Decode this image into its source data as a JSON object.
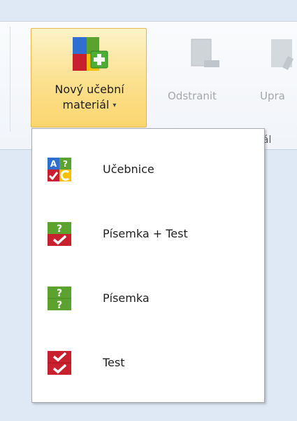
{
  "ribbon": {
    "group_label_partial": "iál",
    "new_material": {
      "label_line1": "Nový učební",
      "label_line2": "materiál",
      "caret": "▾",
      "icon": "new-material-icon"
    },
    "remove": {
      "label": "Odstranit",
      "icon": "remove-icon"
    },
    "edit": {
      "label": "Upra",
      "icon": "edit-icon"
    }
  },
  "menu": {
    "items": [
      {
        "label": "Učebnice",
        "icon": "textbook-icon"
      },
      {
        "label": "Písemka + Test",
        "icon": "written-test-icon"
      },
      {
        "label": "Písemka",
        "icon": "written-exam-icon"
      },
      {
        "label": "Test",
        "icon": "test-icon"
      }
    ]
  },
  "colors": {
    "accent_border": "#e3b94a",
    "accent_fill": "#fbe08e",
    "blue": "#2f6fd1",
    "red": "#c8202e",
    "green": "#5ca22f",
    "yellow": "#f2c200"
  }
}
